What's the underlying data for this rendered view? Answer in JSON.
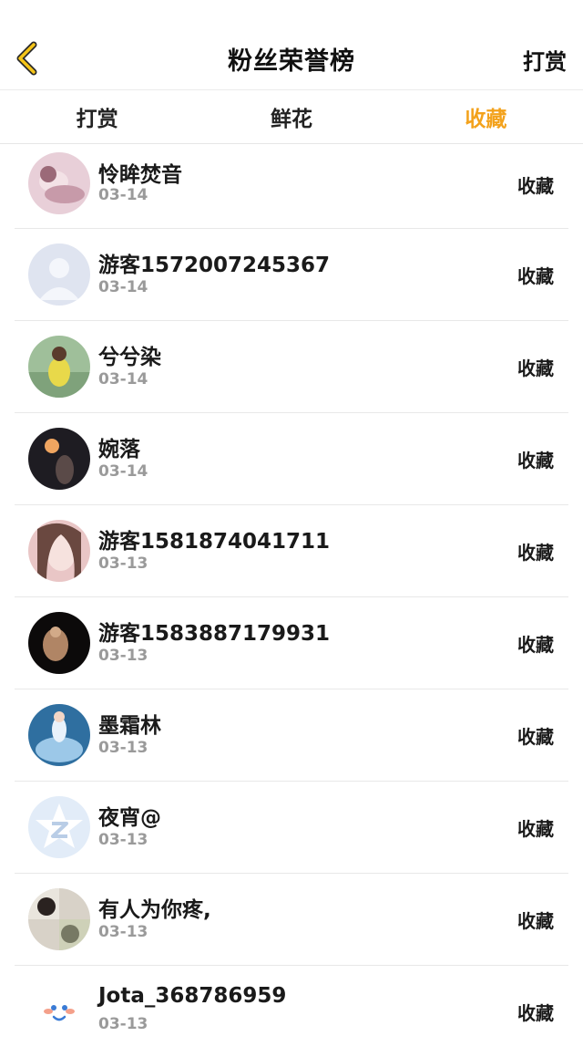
{
  "header": {
    "title": "粉丝荣誉榜",
    "right_action": "打赏",
    "back_icon": "chevron-left-icon"
  },
  "colors": {
    "accent": "#f3a21c"
  },
  "tabs": [
    {
      "label": "打赏",
      "active": false
    },
    {
      "label": "鲜花",
      "active": false
    },
    {
      "label": "收藏",
      "active": true
    }
  ],
  "list": [
    {
      "name": "怜眸焚音",
      "date": "03-14",
      "action": "收藏",
      "avatar": "photo-avatar"
    },
    {
      "name": "游客1572007245367",
      "date": "03-14",
      "action": "收藏",
      "avatar": "default-user-avatar"
    },
    {
      "name": "兮兮染",
      "date": "03-14",
      "action": "收藏",
      "avatar": "photo-avatar"
    },
    {
      "name": "婉落",
      "date": "03-14",
      "action": "收藏",
      "avatar": "photo-avatar"
    },
    {
      "name": "游客1581874041711",
      "date": "03-13",
      "action": "收藏",
      "avatar": "photo-avatar"
    },
    {
      "name": "游客1583887179931",
      "date": "03-13",
      "action": "收藏",
      "avatar": "photo-avatar"
    },
    {
      "name": "墨霜林",
      "date": "03-13",
      "action": "收藏",
      "avatar": "photo-avatar"
    },
    {
      "name": "夜宵@",
      "date": "03-13",
      "action": "收藏",
      "avatar": "qq-star-avatar"
    },
    {
      "name": "有人为你疼,",
      "date": "03-13",
      "action": "收藏",
      "avatar": "photo-avatar"
    },
    {
      "name": "Jota_368786959",
      "date": "03-13",
      "action": "收藏",
      "avatar": "smiley-avatar"
    }
  ]
}
